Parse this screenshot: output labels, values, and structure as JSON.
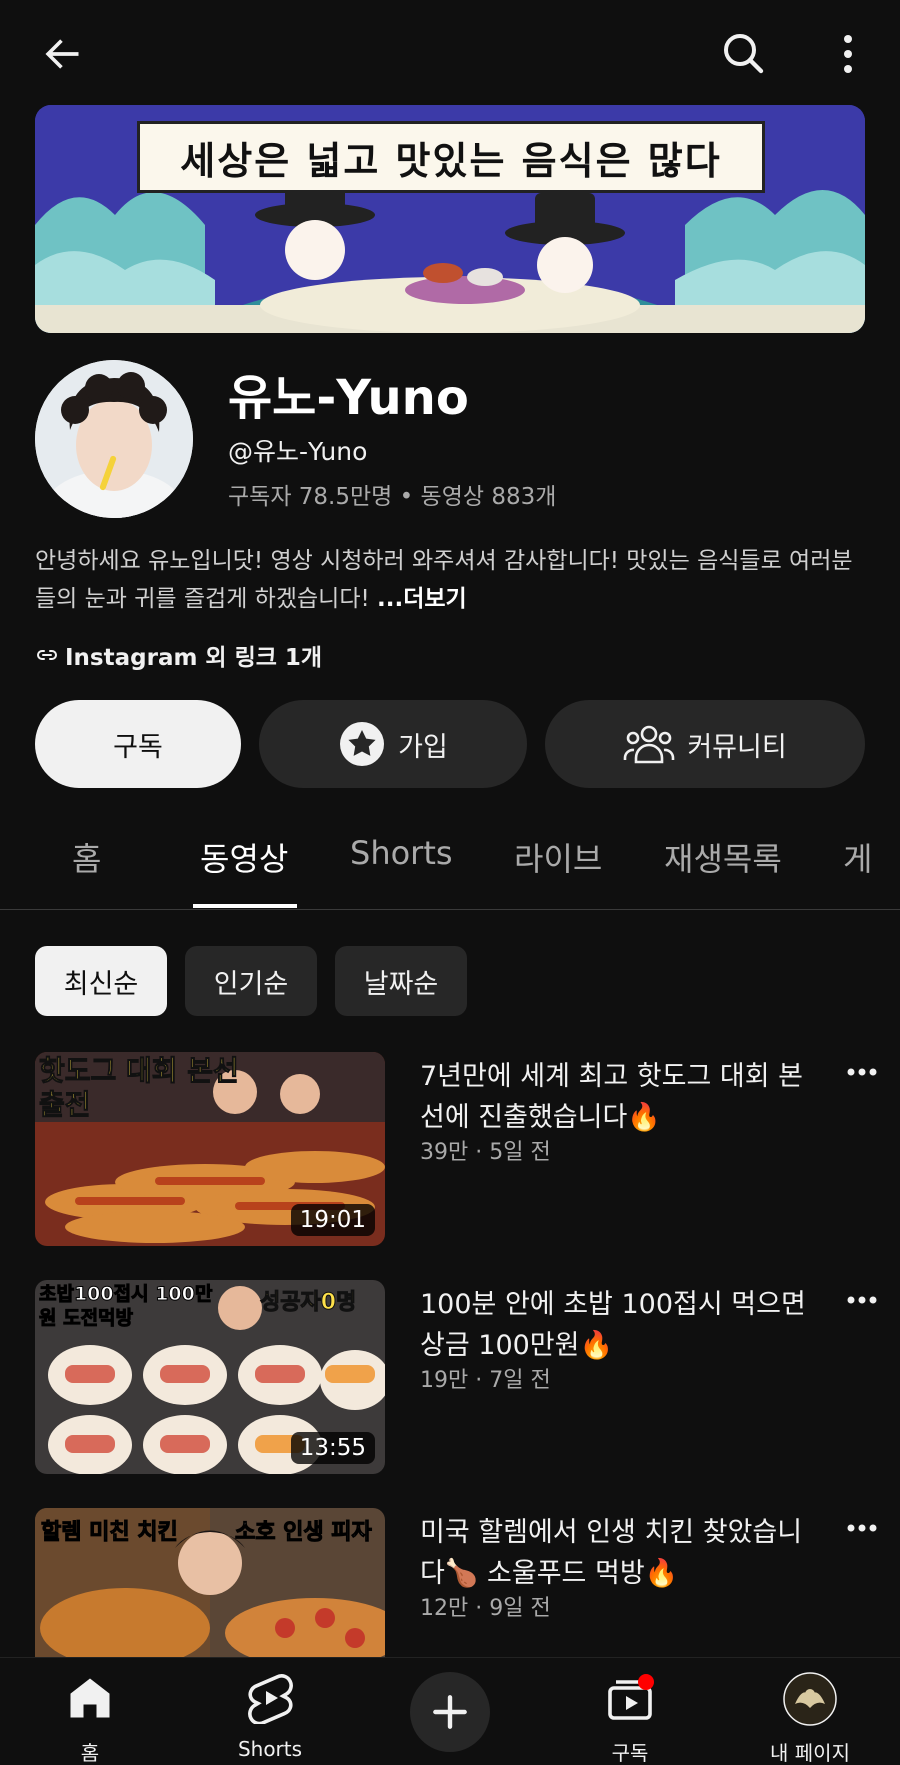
{
  "topbar": {
    "back": "arrow-left-icon",
    "search": "search-icon",
    "more": "more-vertical-icon"
  },
  "banner": {
    "title": "세상은 넓고 맛있는 음식은 많다"
  },
  "channel": {
    "name": "유노-Yuno",
    "handle": "@유노-Yuno",
    "subscribers": "구독자 78.5만명",
    "separator": "•",
    "videos": "동영상 883개",
    "description": "안녕하세요 유노입니닷! 영상 시청하러 와주셔셔 감사합니다! 맛있는 음식들로 여러분들의 눈과 귀를 즐겁게 하겠습니다! ",
    "more_label": "...더보기",
    "links": "Instagram 외 링크 1개"
  },
  "actions": {
    "subscribe": "구독",
    "join": "가입",
    "community": "커뮤니티"
  },
  "tabs": [
    "홈",
    "동영상",
    "Shorts",
    "라이브",
    "재생목록",
    "게"
  ],
  "active_tab": "동영상",
  "chips": [
    "최신순",
    "인기순",
    "날짜순"
  ],
  "videos": [
    {
      "title": "7년만에 세계 최고 핫도그 대회 본선에 진출했습니다🔥",
      "meta": "39만 · 5일 전",
      "duration": "19:01",
      "thumb_text": "핫도그 대회 본선 출전"
    },
    {
      "title": "100분 안에 초밥 100접시 먹으면 상금 100만원🔥",
      "meta": "19만 · 7일 전",
      "duration": "13:55",
      "thumb_text": "초밥100접시 100만원 도전먹방",
      "thumb_text2": "성공자0명"
    },
    {
      "title": "미국 할렘에서 인생 치킨 찾았습니다🍗 소울푸드 먹방🔥",
      "meta": "12만 · 9일 전",
      "duration": "",
      "thumb_text": "할렘 미친 치킨",
      "thumb_text2": "소호 인생 피자"
    }
  ],
  "bottom_nav": {
    "home": "홈",
    "shorts": "Shorts",
    "subscriptions": "구독",
    "you": "내 페이지"
  },
  "colors": {
    "background": "#0f0f0f",
    "surface": "#272727",
    "text": "#f1f1f1",
    "muted": "#aaaaaa",
    "accent": "#ff0000"
  }
}
